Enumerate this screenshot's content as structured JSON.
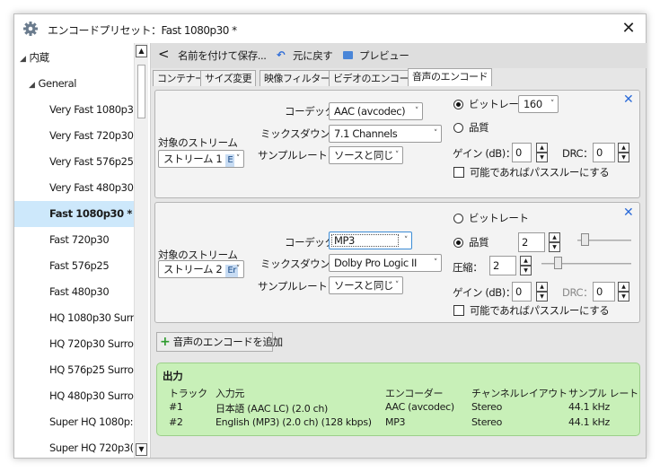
{
  "window": {
    "title": "エンコードプリセット：Fast 1080p30 *",
    "close_label": "✕"
  },
  "sidebar": {
    "root": "内蔵",
    "group": "General",
    "items": [
      {
        "label": "Very Fast 1080p3(",
        "selected": false
      },
      {
        "label": "Very Fast 720p30",
        "selected": false
      },
      {
        "label": "Very Fast 576p25",
        "selected": false
      },
      {
        "label": "Very Fast 480p30",
        "selected": false
      },
      {
        "label": "Fast 1080p30 *",
        "selected": true
      },
      {
        "label": "Fast 720p30",
        "selected": false
      },
      {
        "label": "Fast 576p25",
        "selected": false
      },
      {
        "label": "Fast 480p30",
        "selected": false
      },
      {
        "label": "HQ 1080p30 Surr",
        "selected": false
      },
      {
        "label": "HQ 720p30 Surro",
        "selected": false
      },
      {
        "label": "HQ 576p25 Surro",
        "selected": false
      },
      {
        "label": "HQ 480p30 Surro",
        "selected": false
      },
      {
        "label": "Super HQ 1080p:",
        "selected": false
      },
      {
        "label": "Super HQ 720p3(",
        "selected": false
      }
    ]
  },
  "toolbar": {
    "back": "<",
    "save_as": "名前を付けて保存...",
    "revert": "元に戻す",
    "preview": "プレビュー"
  },
  "tabs": [
    "コンテナー",
    "サイズ変更",
    "映像フィルター",
    "ビデオのエンコード",
    "音声のエンコード"
  ],
  "active_tab": 4,
  "track1": {
    "stream_label": "対象のストリーム",
    "stream_value": "ストリーム 1",
    "stream_badge": "E",
    "codec_label": "コーデック:",
    "codec_value": "AAC (avcodec)",
    "mixdown_label": "ミックスダウン：",
    "mixdown_value": "7.1 Channels",
    "samplerate_label": "サンプルレート：",
    "samplerate_value": "ソースと同じ",
    "bitrate_label": "ビットレート",
    "bitrate_value": "160",
    "quality_label": "品質",
    "gain_label": "ゲイン (dB)：",
    "gain_value": "0",
    "drc_label": "DRC：",
    "drc_value": "0",
    "passthru_label": "可能であればパススルーにする",
    "mode": "bitrate"
  },
  "track2": {
    "stream_label": "対象のストリーム",
    "stream_value": "ストリーム 2",
    "stream_badge": "Er",
    "codec_label": "コーデック:",
    "codec_value": "MP3",
    "mixdown_label": "ミックスダウン：",
    "mixdown_value": "Dolby Pro Logic II",
    "samplerate_label": "サンプルレート：",
    "samplerate_value": "ソースと同じ",
    "bitrate_label": "ビットレート",
    "quality_label": "品質",
    "quality_value": "2",
    "compression_label": "圧縮：",
    "compression_value": "2",
    "gain_label": "ゲイン (dB)：",
    "gain_value": "0",
    "drc_label": "DRC：",
    "drc_value": "0",
    "passthru_label": "可能であればパススルーにする",
    "mode": "quality"
  },
  "add_track_label": "音声のエンコードを追加",
  "output": {
    "title": "出力",
    "headers": [
      "トラック",
      "入力元",
      "エンコーダー",
      "チャンネルレイアウト",
      "サンプル レート"
    ],
    "rows": [
      [
        "#1",
        "日本語 (AAC LC) (2.0 ch)",
        "AAC (avcodec)",
        "Stereo",
        "44.1 kHz"
      ],
      [
        "#2",
        "English (MP3) (2.0 ch) (128 kbps)",
        "MP3",
        "Stereo",
        "44.1 kHz"
      ]
    ]
  },
  "colors": {
    "selection": "#cde8fb",
    "output_bg": "#c8f0b8",
    "accent": "#2a6ad8",
    "add_icon": "#2e9b2e"
  }
}
